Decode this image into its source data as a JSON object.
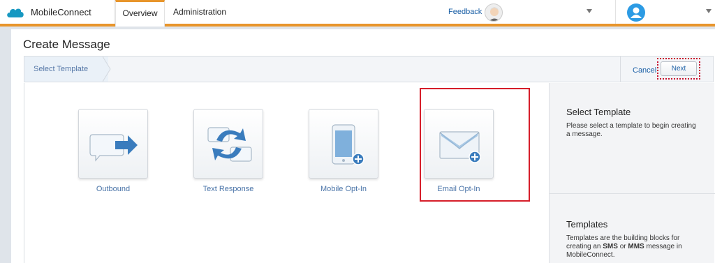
{
  "app": {
    "name": "MobileConnect"
  },
  "nav": {
    "tabs": [
      {
        "label": "Overview"
      },
      {
        "label": "Administration"
      }
    ]
  },
  "header": {
    "feedback_label": "Feedback"
  },
  "page": {
    "title": "Create Message"
  },
  "wizard": {
    "step_label": "Select Template",
    "cancel_label": "Cancel",
    "next_label": "Next"
  },
  "templates": [
    {
      "label": "Outbound",
      "icon": "outbound-message-icon"
    },
    {
      "label": "Text Response",
      "icon": "text-response-icon"
    },
    {
      "label": "Mobile Opt-In",
      "icon": "mobile-opt-in-icon"
    },
    {
      "label": "Email Opt-In",
      "icon": "email-opt-in-icon"
    }
  ],
  "sidebar": {
    "select_heading": "Select Template",
    "select_text": "Please select a template to begin creating a message.",
    "templates_heading": "Templates",
    "templates_text_1": "Templates are the building blocks for creating an ",
    "templates_sms": "SMS",
    "templates_text_2": " or ",
    "templates_mms": "MMS",
    "templates_text_3": " message in MobileConnect."
  },
  "colors": {
    "accent": "#e8952b",
    "link": "#1a5fa6",
    "highlight": "#d61e2a",
    "avatar": "#2c9be4"
  }
}
